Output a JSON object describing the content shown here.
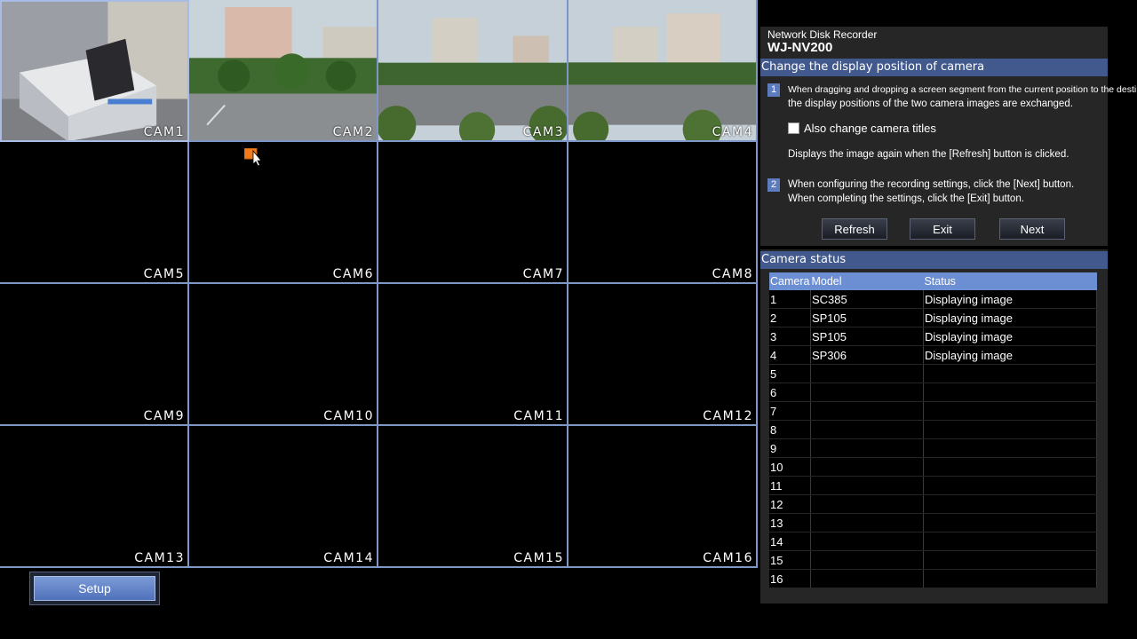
{
  "cameras": [
    "CAM1",
    "CAM2",
    "CAM3",
    "CAM4",
    "CAM5",
    "CAM6",
    "CAM7",
    "CAM8",
    "CAM9",
    "CAM10",
    "CAM11",
    "CAM12",
    "CAM13",
    "CAM14",
    "CAM15",
    "CAM16"
  ],
  "setup_label": "Setup",
  "recorder": {
    "subtitle": "Network Disk Recorder",
    "model": "WJ-NV200"
  },
  "display_position": {
    "title": "Change the display position of camera",
    "step1_num": "1",
    "step1_line1": "When dragging and dropping a screen segment from the current position to the destination,",
    "step1_line2": "the display positions of the two camera images are exchanged.",
    "checkbox_label": "Also change camera titles",
    "refresh_note": "Displays the image again when the [Refresh] button is clicked.",
    "step2_num": "2",
    "step2_line1": "When configuring the recording settings, click the [Next] button.",
    "step2_line2": "When completing the settings, click the [Exit] button.",
    "buttons": {
      "refresh": "Refresh",
      "exit": "Exit",
      "next": "Next"
    }
  },
  "camera_status": {
    "title": "Camera status",
    "headers": [
      "Camera",
      "Model",
      "Status"
    ],
    "rows": [
      [
        "1",
        "SC385",
        "Displaying image"
      ],
      [
        "2",
        "SP105",
        "Displaying image"
      ],
      [
        "3",
        "SP105",
        "Displaying image"
      ],
      [
        "4",
        "SP306",
        "Displaying image"
      ],
      [
        "5",
        "",
        ""
      ],
      [
        "6",
        "",
        ""
      ],
      [
        "7",
        "",
        ""
      ],
      [
        "8",
        "",
        ""
      ],
      [
        "9",
        "",
        ""
      ],
      [
        "10",
        "",
        ""
      ],
      [
        "11",
        "",
        ""
      ],
      [
        "12",
        "",
        ""
      ],
      [
        "13",
        "",
        ""
      ],
      [
        "14",
        "",
        ""
      ],
      [
        "15",
        "",
        ""
      ],
      [
        "16",
        "",
        ""
      ]
    ]
  },
  "colors": {
    "grid_line": "#7f96c8",
    "section_bar": "#41598c",
    "table_header": "#6c8ed2"
  }
}
